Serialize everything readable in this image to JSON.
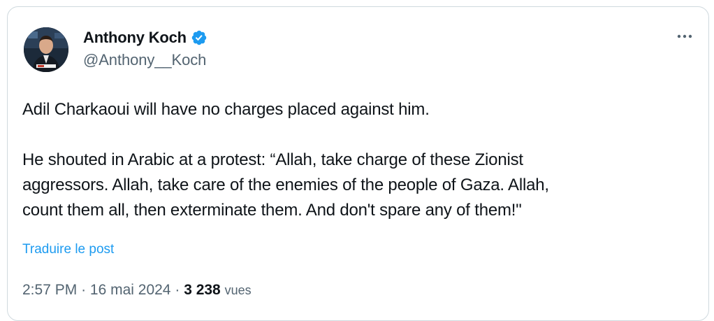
{
  "author": {
    "display_name": "Anthony Koch",
    "handle": "@Anthony__Koch",
    "verified": true
  },
  "tweet": {
    "paragraphs": [
      [
        "Adil Charkaoui will have no charges placed against him."
      ],
      [
        "He shouted in Arabic at a protest: “Allah, take charge of these Zionist",
        "aggressors. Allah, take care of the enemies of the people of Gaza. Allah,",
        "count them all, then exterminate them. And don't spare any of them!\""
      ]
    ],
    "translate_label": "Traduire le post"
  },
  "meta": {
    "time": "2:57 PM",
    "separator": "·",
    "date": "16 mai 2024",
    "views_count": "3 238",
    "views_label": "vues"
  },
  "colors": {
    "text": "#0f1419",
    "secondary": "#536471",
    "link": "#1d9bf0",
    "verified": "#1d9bf0",
    "border": "#cfd9de"
  },
  "icons": {
    "verified": "verified-badge-icon",
    "more": "more-options-icon"
  }
}
